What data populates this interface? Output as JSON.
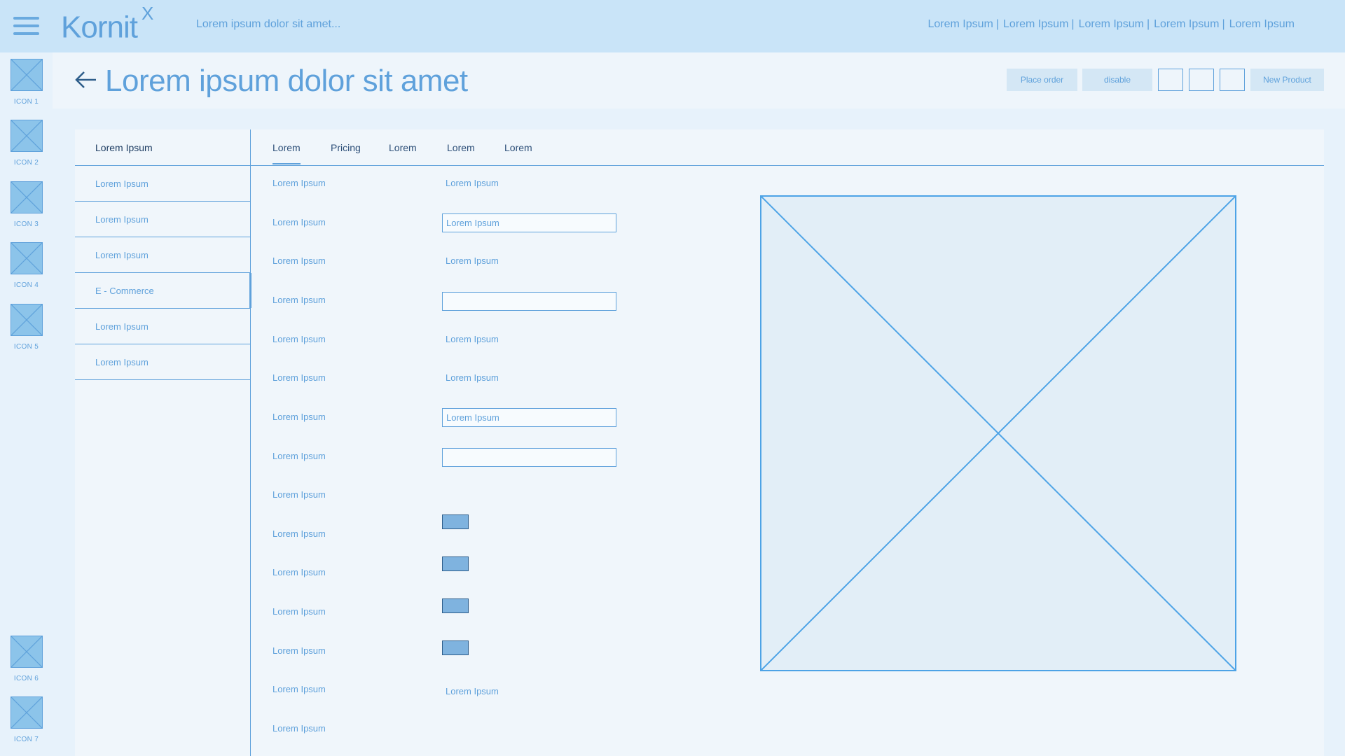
{
  "header": {
    "logo": "Kornit",
    "logo_sup": "X",
    "subtitle": "Lorem ipsum dolor sit amet...",
    "links": [
      "Lorem Ipsum",
      "Lorem Ipsum",
      "Lorem Ipsum",
      "Lorem Ipsum",
      "Lorem Ipsum"
    ],
    "separator": "|"
  },
  "rail": {
    "items": [
      {
        "label": "ICON 1"
      },
      {
        "label": "ICON 2"
      },
      {
        "label": "ICON 3"
      },
      {
        "label": "ICON 4"
      },
      {
        "label": "ICON 5"
      },
      {
        "label": "ICON 6"
      },
      {
        "label": "ICON 7"
      }
    ]
  },
  "titlebar": {
    "title": "Lorem ipsum dolor sit amet",
    "place_order": "Place order",
    "disable": "disable",
    "new_product": "New Product"
  },
  "side_nav": {
    "header": "Lorem Ipsum",
    "items": [
      "Lorem Ipsum",
      "Lorem Ipsum",
      "Lorem Ipsum",
      "E - Commerce",
      "Lorem Ipsum",
      "Lorem Ipsum"
    ],
    "active_index": 3
  },
  "tabs": [
    "Lorem",
    "Pricing",
    "Lorem",
    "Lorem",
    "Lorem"
  ],
  "form": {
    "labels": [
      "Lorem Ipsum",
      "Lorem Ipsum",
      "Lorem Ipsum",
      "Lorem Ipsum",
      "Lorem Ipsum",
      "Lorem Ipsum",
      "Lorem Ipsum",
      "Lorem Ipsum",
      "Lorem Ipsum",
      "Lorem Ipsum",
      "Lorem Ipsum",
      "Lorem Ipsum",
      "Lorem Ipsum",
      "Lorem Ipsum",
      "Lorem Ipsum"
    ],
    "values": {
      "row1": "Lorem Ipsum",
      "row2_input": "Lorem Ipsum",
      "row3": "Lorem Ipsum",
      "row4_input": "",
      "row5": "Lorem Ipsum",
      "row6": "Lorem Ipsum",
      "row7_input": "Lorem Ipsum",
      "row8_input": "",
      "row14": "Lorem Ipsum"
    }
  },
  "colors": {
    "accent": "#5fa1db",
    "header_bg": "#c9e4f8",
    "swatch": "#7fb3df"
  }
}
